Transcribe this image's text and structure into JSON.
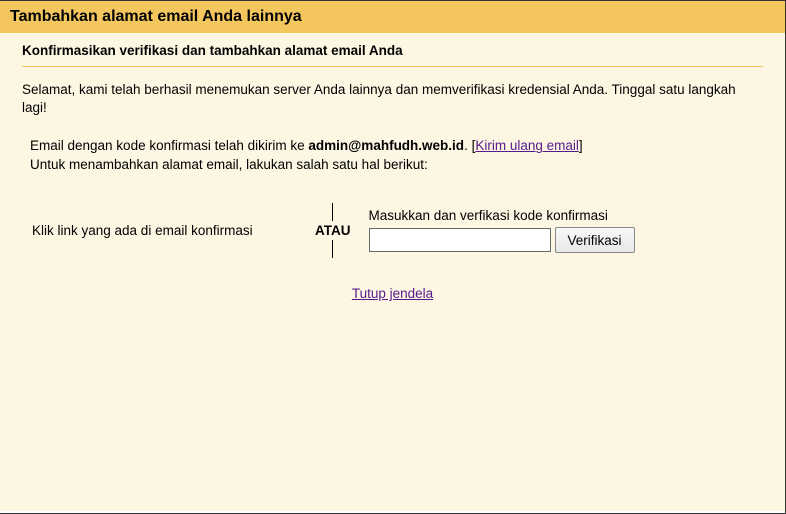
{
  "header": {
    "title": "Tambahkan alamat email Anda lainnya"
  },
  "subtitle": "Konfirmasikan verifikasi dan tambahkan alamat email Anda",
  "successText": "Selamat, kami telah berhasil menemukan server Anda lainnya dan memverifikasi kredensial Anda. Tinggal satu langkah lagi!",
  "instructions": {
    "prefix": "Email dengan kode konfirmasi telah dikirim ke ",
    "email": "admin@mahfudh.web.id",
    "afterEmail": ". [",
    "resendLink": "Kirim ulang email",
    "afterLink": "]",
    "line2": "Untuk menambahkan alamat email, lakukan salah satu hal berikut:"
  },
  "options": {
    "leftText": "Klik link yang ada di email konfirmasi",
    "separator": "ATAU",
    "rightLabel": "Masukkan dan verfikasi kode konfirmasi",
    "verifyButton": "Verifikasi"
  },
  "closeLink": "Tutup jendela"
}
